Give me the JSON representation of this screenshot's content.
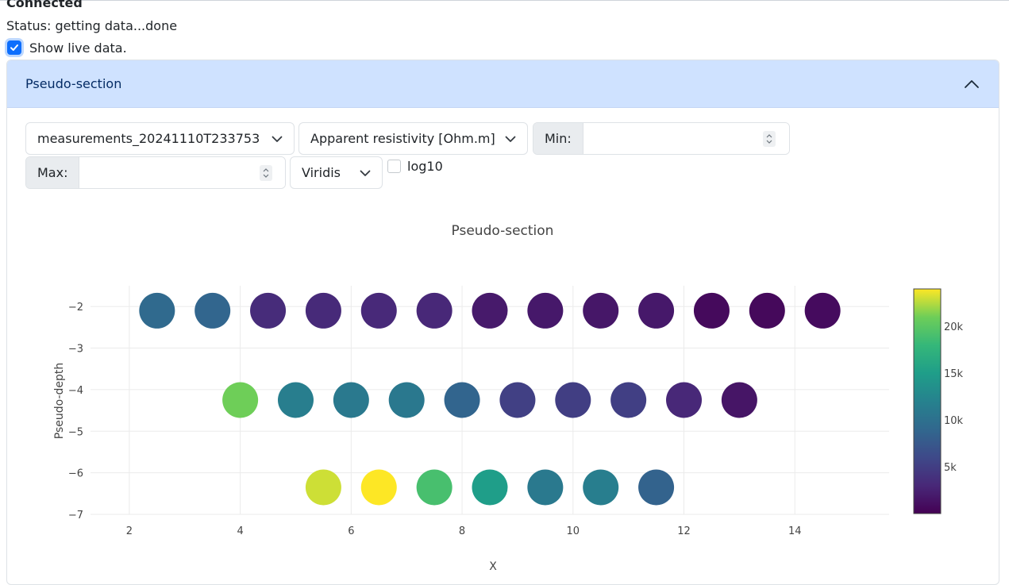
{
  "connection": {
    "title": "Connected",
    "status": "Status: getting data...done",
    "live_label": "Show live data.",
    "live_checked": true
  },
  "accordion": {
    "title": "Pseudo-section"
  },
  "controls": {
    "dataset": "measurements_20241110T233753",
    "quantity": "Apparent resistivity [Ohm.m]",
    "min_label": "Min:",
    "min_value": "",
    "max_label": "Max:",
    "max_value": "",
    "colormap": "Viridis",
    "log_label": "log10",
    "log_checked": false
  },
  "chart_data": {
    "type": "scatter",
    "title": "Pseudo-section",
    "xlabel": "X",
    "ylabel": "Pseudo-depth",
    "xlim": [
      1.3,
      15.7
    ],
    "ylim": [
      -7,
      -1.5
    ],
    "x_ticks": [
      2,
      4,
      6,
      8,
      10,
      12,
      14
    ],
    "y_ticks": [
      -2,
      -3,
      -4,
      -5,
      -6,
      -7
    ],
    "y_tick_labels": [
      "−2",
      "−3",
      "−4",
      "−5",
      "−6",
      "−7"
    ],
    "grid": true,
    "colorscale": "viridis",
    "color_range": [
      0,
      24000
    ],
    "colorbar_ticks": [
      5000,
      10000,
      15000,
      20000
    ],
    "colorbar_tick_labels": [
      "5k",
      "10k",
      "15k",
      "20k"
    ],
    "points": [
      {
        "x": 2.5,
        "y": -2.1,
        "value": 9200
      },
      {
        "x": 3.5,
        "y": -2.1,
        "value": 8800
      },
      {
        "x": 4.5,
        "y": -2.1,
        "value": 3400
      },
      {
        "x": 5.5,
        "y": -2.1,
        "value": 3200
      },
      {
        "x": 6.5,
        "y": -2.1,
        "value": 3100
      },
      {
        "x": 7.5,
        "y": -2.1,
        "value": 3000
      },
      {
        "x": 8.5,
        "y": -2.1,
        "value": 1900
      },
      {
        "x": 9.5,
        "y": -2.1,
        "value": 1800
      },
      {
        "x": 10.5,
        "y": -2.1,
        "value": 1700
      },
      {
        "x": 11.5,
        "y": -2.1,
        "value": 1800
      },
      {
        "x": 12.5,
        "y": -2.1,
        "value": 700
      },
      {
        "x": 13.5,
        "y": -2.1,
        "value": 600
      },
      {
        "x": 14.5,
        "y": -2.1,
        "value": 800
      },
      {
        "x": 4,
        "y": -4.25,
        "value": 21000
      },
      {
        "x": 5,
        "y": -4.25,
        "value": 11500
      },
      {
        "x": 6,
        "y": -4.25,
        "value": 11000
      },
      {
        "x": 7,
        "y": -4.25,
        "value": 10800
      },
      {
        "x": 8,
        "y": -4.25,
        "value": 8700
      },
      {
        "x": 9,
        "y": -4.25,
        "value": 5200
      },
      {
        "x": 10,
        "y": -4.25,
        "value": 5000
      },
      {
        "x": 11,
        "y": -4.25,
        "value": 5100
      },
      {
        "x": 12,
        "y": -4.25,
        "value": 3000
      },
      {
        "x": 13,
        "y": -4.25,
        "value": 1500
      },
      {
        "x": 5.5,
        "y": -6.35,
        "value": 23000
      },
      {
        "x": 6.5,
        "y": -6.35,
        "value": 24000
      },
      {
        "x": 7.5,
        "y": -6.35,
        "value": 19000
      },
      {
        "x": 8.5,
        "y": -6.35,
        "value": 15000
      },
      {
        "x": 9.5,
        "y": -6.35,
        "value": 11000
      },
      {
        "x": 10.5,
        "y": -6.35,
        "value": 11500
      },
      {
        "x": 11.5,
        "y": -6.35,
        "value": 8500
      }
    ]
  }
}
